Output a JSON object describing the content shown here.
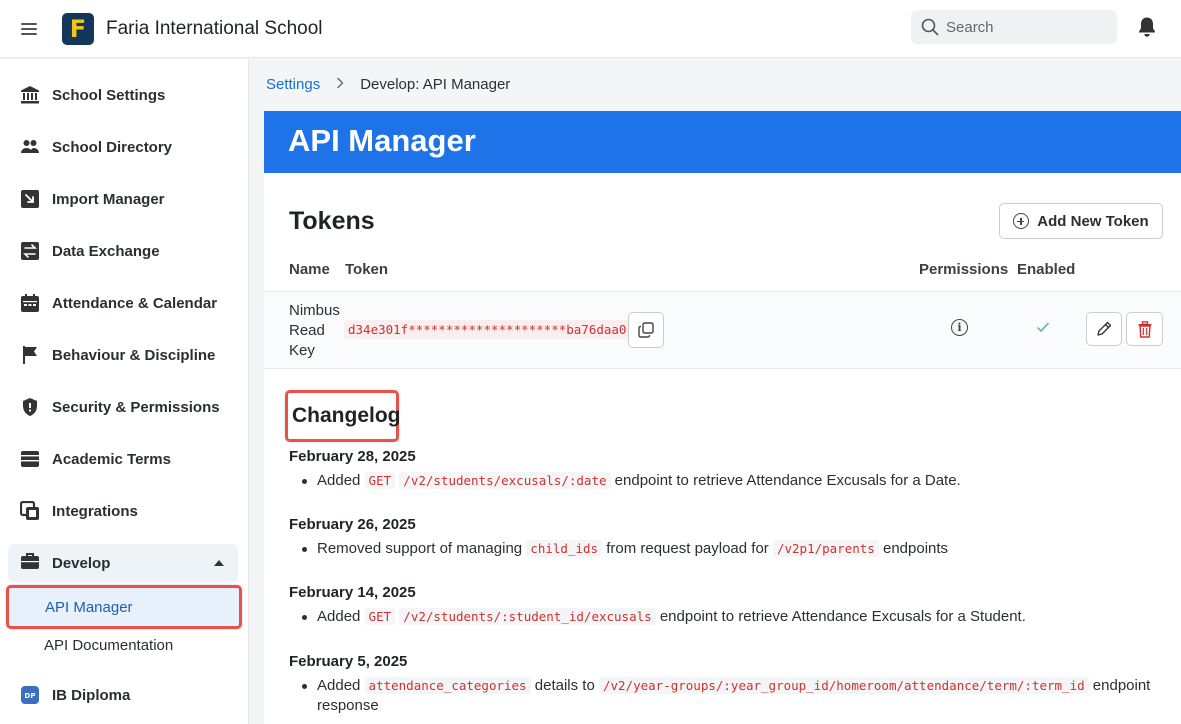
{
  "header": {
    "logo_letter": "F",
    "school_name": "Faria International School",
    "search_placeholder": "Search"
  },
  "sidebar": {
    "items": [
      {
        "label": "School Settings",
        "icon": "bank-icon"
      },
      {
        "label": "School Directory",
        "icon": "people-icon"
      },
      {
        "label": "Import Manager",
        "icon": "import-icon"
      },
      {
        "label": "Data Exchange",
        "icon": "exchange-icon"
      },
      {
        "label": "Attendance & Calendar",
        "icon": "calendar-icon"
      },
      {
        "label": "Behaviour & Discipline",
        "icon": "flag-icon"
      },
      {
        "label": "Security & Permissions",
        "icon": "shield-icon"
      },
      {
        "label": "Academic Terms",
        "icon": "terms-icon"
      },
      {
        "label": "Integrations",
        "icon": "integrations-icon"
      }
    ],
    "develop": {
      "label": "Develop",
      "sub_items": [
        "API Manager",
        "API Documentation"
      ]
    },
    "ib_diploma": {
      "label": "IB Diploma",
      "badge": "DP"
    }
  },
  "breadcrumb": {
    "parent": "Settings",
    "current": "Develop: API Manager"
  },
  "main": {
    "title": "API Manager",
    "tokens_title": "Tokens",
    "add_token_label": "Add New Token",
    "columns": {
      "name": "Name",
      "token": "Token",
      "permissions": "Permissions",
      "enabled": "Enabled"
    },
    "token_row": {
      "name": "Nimbus Read Key",
      "token": "d34e301f*********************ba76daa0",
      "info_glyph": "i",
      "enabled_glyph": "✓"
    },
    "changelog_title": "Changelog",
    "changelog": [
      {
        "date": "February 28, 2025",
        "pre": "Added",
        "code1": "GET",
        "code2": "/v2/students/excusals/:date",
        "post": "endpoint to retrieve Attendance Excusals for a Date."
      },
      {
        "date": "February 26, 2025",
        "pre": "Removed support of managing",
        "code1": "child_ids",
        "mid": "from request payload for",
        "code2": "/v2p1/parents",
        "post": "endpoints"
      },
      {
        "date": "February 14, 2025",
        "pre": "Added",
        "code1": "GET",
        "code2": "/v2/students/:student_id/excusals",
        "post": "endpoint to retrieve Attendance Excusals for a Student."
      },
      {
        "date": "February 5, 2025",
        "pre": "Added",
        "code1": "attendance_categories",
        "mid": "details to",
        "code2": "/v2/year-groups/:year_group_id/homeroom/attendance/term/:term_id",
        "post": "endpoint response"
      }
    ]
  },
  "colors": {
    "banner": "#1e73e8",
    "link": "#1a6fd1",
    "code": "#d0312d",
    "highlight": "#e5534b"
  }
}
